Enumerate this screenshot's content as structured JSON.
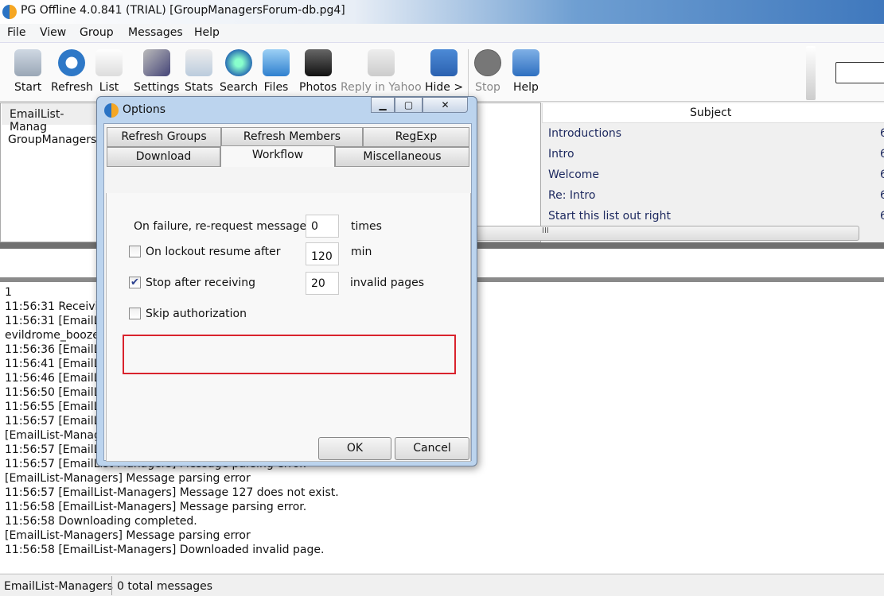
{
  "window": {
    "title": "PG Offline 4.0.841 (TRIAL) [GroupManagersForum-db.pg4]"
  },
  "menu": [
    "File",
    "View",
    "Group",
    "Messages",
    "Help"
  ],
  "toolbar": [
    {
      "label": "Start",
      "icon": "start-icon",
      "enabled": true
    },
    {
      "label": "Refresh",
      "icon": "refresh-icon",
      "enabled": true
    },
    {
      "label": "List",
      "icon": "list-icon",
      "enabled": true
    },
    {
      "label": "Settings",
      "icon": "settings-icon",
      "enabled": true
    },
    {
      "label": "Stats",
      "icon": "stats-icon",
      "enabled": true
    },
    {
      "label": "Search",
      "icon": "search-icon",
      "enabled": true
    },
    {
      "label": "Files",
      "icon": "folder-icon",
      "enabled": true
    },
    {
      "label": "Photos",
      "icon": "camera-icon",
      "enabled": true
    },
    {
      "label": "Reply in Yahoo",
      "icon": "reply-icon",
      "enabled": false
    },
    {
      "label": "Hide >",
      "icon": "arrow-down-icon",
      "enabled": true
    },
    {
      "label": "Stop",
      "icon": "stop-icon",
      "enabled": false
    },
    {
      "label": "Help",
      "icon": "help-icon",
      "enabled": true
    }
  ],
  "groups": {
    "header": "EmailList-Manag",
    "items": [
      "GroupManagersF"
    ]
  },
  "messages": {
    "subject_header": "Subject",
    "rows": [
      {
        "subject": "Introductions",
        "extra": "6"
      },
      {
        "subject": "Intro",
        "extra": "6"
      },
      {
        "subject": "Welcome",
        "extra": "6"
      },
      {
        "subject": "Re: Intro",
        "extra": "6"
      },
      {
        "subject": "Start this list out right",
        "extra": "6"
      }
    ],
    "scroll_grip": "III"
  },
  "log": [
    "1",
    "11:56:31 Receivi",
    "11:56:31 [EmailL",
    "evildrome_boozer",
    "11:56:36 [EmailL",
    "11:56:41 [EmailL",
    "11:56:46 [EmailL",
    "11:56:50 [EmailL",
    "11:56:55 [EmailL",
    "11:56:57 [EmailL",
    "[EmailList-Manag",
    "11:56:57 [EmailL",
    "11:56:57 [EmailList-Managers] Message parsing error.",
    "[EmailList-Managers] Message parsing error",
    "11:56:57 [EmailList-Managers] Message 127 does not exist.",
    "11:56:58 [EmailList-Managers] Message parsing error.",
    "11:56:58 Downloading completed.",
    "[EmailList-Managers] Message parsing error",
    "11:56:58 [EmailList-Managers] Downloaded invalid page."
  ],
  "status": {
    "group": "EmailList-Managers",
    "count": "0 total messages"
  },
  "dialog": {
    "title": "Options",
    "tabs_row1": [
      "Refresh Groups",
      "Refresh Members",
      "RegExp"
    ],
    "tabs_row2": [
      "Download",
      "Workflow",
      "Miscellaneous"
    ],
    "active_tab": "Workflow",
    "rerequest": {
      "label": "On failure, re-request message",
      "value": "0",
      "unit": "times"
    },
    "lockout": {
      "label": "On lockout resume after",
      "value": "120",
      "unit": "min",
      "checked": false
    },
    "stop_after": {
      "label": "Stop after receiving",
      "value": "20",
      "unit": "invalid pages",
      "checked": true,
      "highlight_color": "#d9232d"
    },
    "skip_auth": {
      "label": "Skip authorization",
      "checked": false
    },
    "ok": "OK",
    "cancel": "Cancel",
    "check_mark": "✔"
  }
}
